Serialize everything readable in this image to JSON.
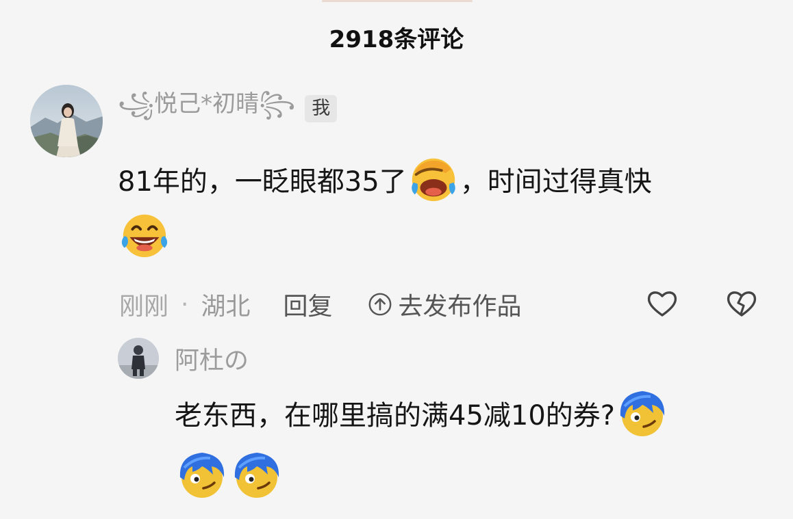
{
  "header": {
    "title": "2918条评论"
  },
  "main_comment": {
    "username": "꧁悦己*初晴꧂",
    "badge": "我",
    "text_part1": "81年的，一眨眼都35了",
    "text_part2": "，时间过得真快",
    "emoji_inline": "facepalm-laugh-emoji",
    "emoji_end": "laughing-tears-emoji",
    "time": "刚刚",
    "location": "湖北",
    "reply_label": "回复",
    "publish_label": "去发布作品"
  },
  "reply_comment": {
    "username": "阿杜の",
    "text": "老东西，在哪里搞的满45减10的券?",
    "emojis": [
      "blue-hair-smirk-emoji",
      "blue-hair-smirk-emoji",
      "blue-hair-smirk-emoji"
    ]
  },
  "icons": {
    "like": "heart-icon",
    "dislike": "broken-heart-icon",
    "publish": "upload-arrow-icon"
  }
}
